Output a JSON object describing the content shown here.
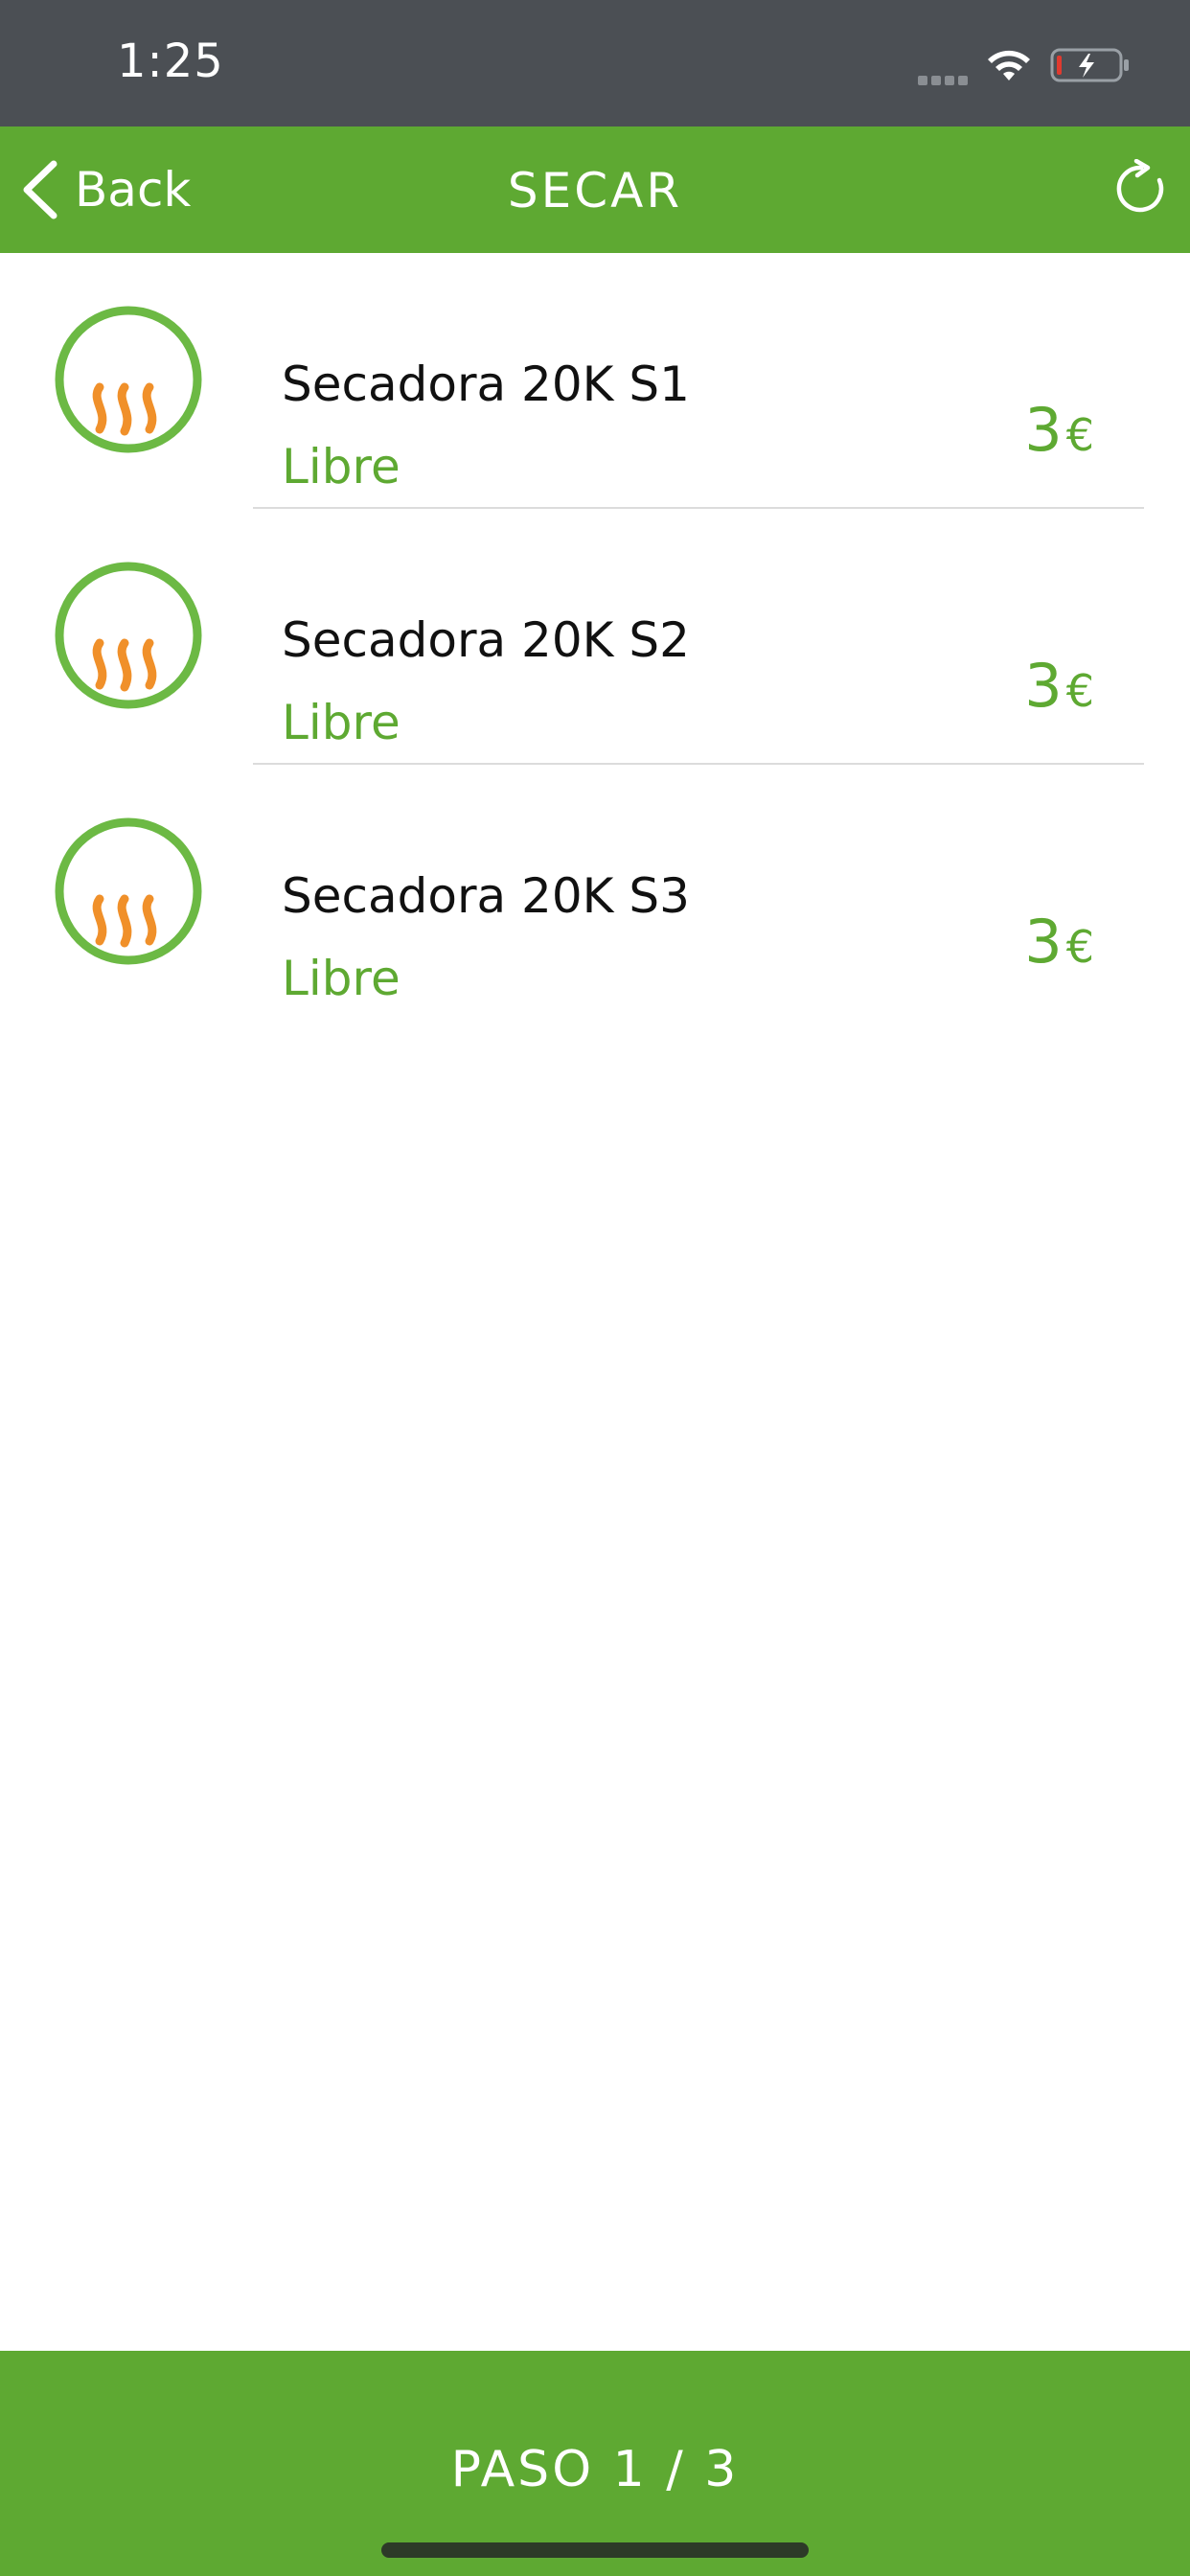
{
  "status_bar": {
    "time": "1:25",
    "icons": [
      "signal-dots-icon",
      "wifi-icon",
      "battery-charging-icon"
    ],
    "battery_low_color": "#e03a2f"
  },
  "nav_bar": {
    "back_label": "Back",
    "title": "SECAR",
    "refresh_icon": "refresh-icon",
    "background_color": "#5ea932"
  },
  "machines": [
    {
      "name": "Secadora 20K S1",
      "status": "Libre",
      "price": "3",
      "currency": "€",
      "icon": "dryer-heat-icon"
    },
    {
      "name": "Secadora 20K S2",
      "status": "Libre",
      "price": "3",
      "currency": "€",
      "icon": "dryer-heat-icon"
    },
    {
      "name": "Secadora 20K S3",
      "status": "Libre",
      "price": "3",
      "currency": "€",
      "icon": "dryer-heat-icon"
    }
  ],
  "footer": {
    "step_label": "PASO 1 / 3"
  },
  "colors": {
    "accent_green": "#5ea932",
    "icon_ring_green": "#6cb944",
    "heat_orange": "#f0902a",
    "status_bar_gray": "#4b4f54"
  }
}
